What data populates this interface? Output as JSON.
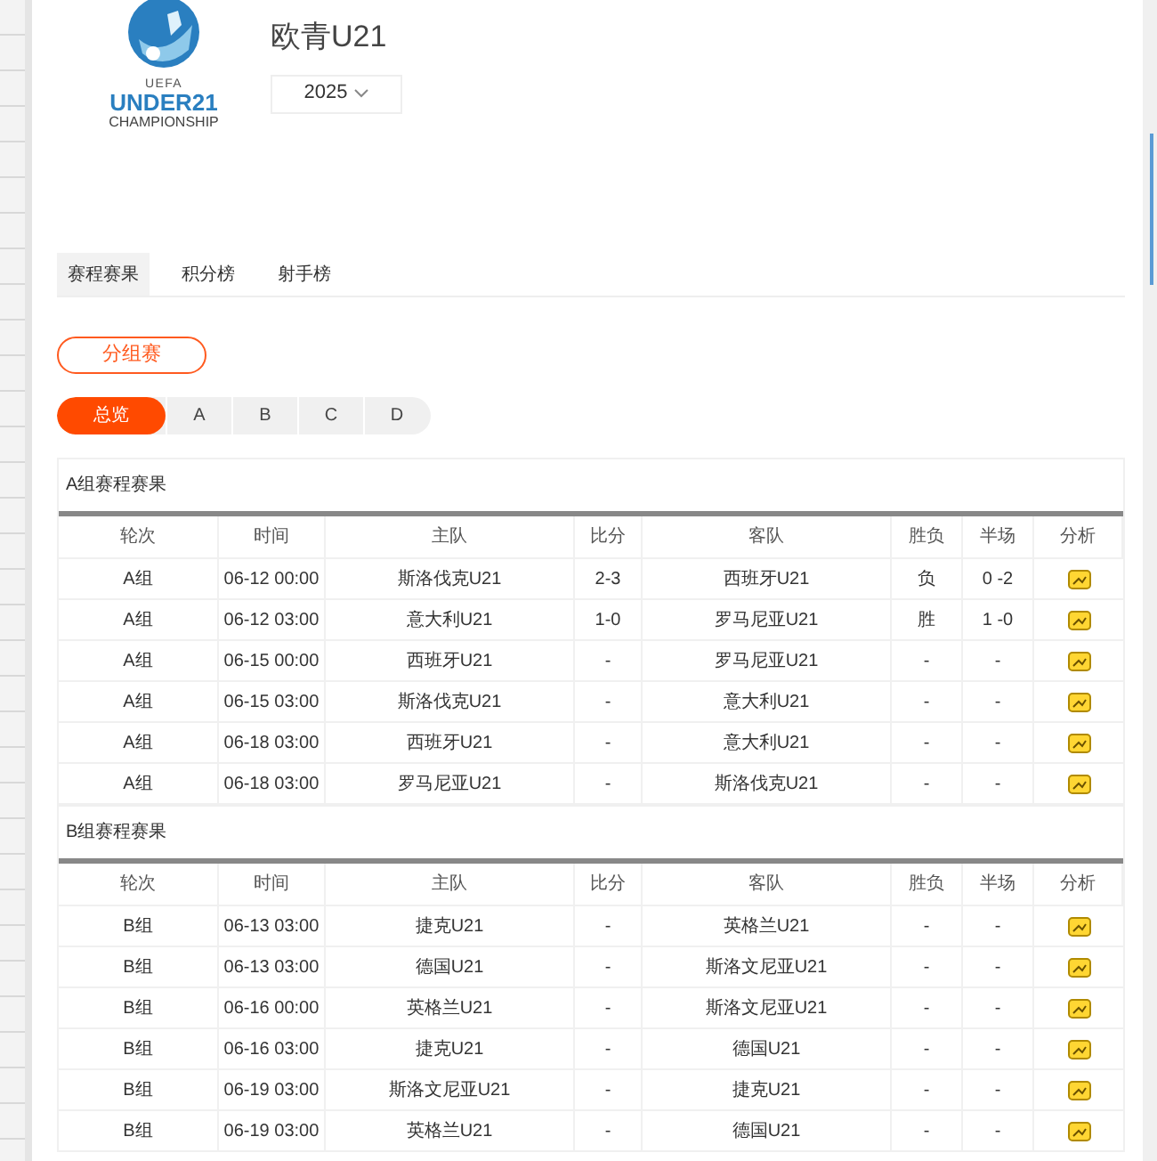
{
  "logo": {
    "top": "UEFA",
    "main": "UNDER21",
    "sub": "CHAMPIONSHIP"
  },
  "title": "欧青U21",
  "season": {
    "value": "2025"
  },
  "tabs": [
    {
      "label": "赛程赛果",
      "selected": true
    },
    {
      "label": "积分榜",
      "selected": false
    },
    {
      "label": "射手榜",
      "selected": false
    }
  ],
  "stage": {
    "label": "分组赛",
    "selected": true
  },
  "group_filters": [
    {
      "label": "总览",
      "selected": true
    },
    {
      "label": "A",
      "selected": false
    },
    {
      "label": "B",
      "selected": false
    },
    {
      "label": "C",
      "selected": false
    },
    {
      "label": "D",
      "selected": false
    }
  ],
  "sections": [
    {
      "title": "A组赛程赛果",
      "columns": [
        "轮次",
        "时间",
        "主队",
        "比分",
        "客队",
        "胜负",
        "半场",
        "分析"
      ],
      "rows": [
        {
          "round": "A组",
          "time": "06-12 00:00",
          "home": "斯洛伐克U21",
          "score": "2-3",
          "away": "西班牙U21",
          "result": "负",
          "half": "0 -2"
        },
        {
          "round": "A组",
          "time": "06-12 03:00",
          "home": "意大利U21",
          "score": "1-0",
          "away": "罗马尼亚U21",
          "result": "胜",
          "half": "1 -0"
        },
        {
          "round": "A组",
          "time": "06-15 00:00",
          "home": "西班牙U21",
          "score": "-",
          "away": "罗马尼亚U21",
          "result": "-",
          "half": "-"
        },
        {
          "round": "A组",
          "time": "06-15 03:00",
          "home": "斯洛伐克U21",
          "score": "-",
          "away": "意大利U21",
          "result": "-",
          "half": "-"
        },
        {
          "round": "A组",
          "time": "06-18 03:00",
          "home": "西班牙U21",
          "score": "-",
          "away": "意大利U21",
          "result": "-",
          "half": "-"
        },
        {
          "round": "A组",
          "time": "06-18 03:00",
          "home": "罗马尼亚U21",
          "score": "-",
          "away": "斯洛伐克U21",
          "result": "-",
          "half": "-"
        }
      ]
    },
    {
      "title": "B组赛程赛果",
      "columns": [
        "轮次",
        "时间",
        "主队",
        "比分",
        "客队",
        "胜负",
        "半场",
        "分析"
      ],
      "rows": [
        {
          "round": "B组",
          "time": "06-13 03:00",
          "home": "捷克U21",
          "score": "-",
          "away": "英格兰U21",
          "result": "-",
          "half": "-"
        },
        {
          "round": "B组",
          "time": "06-13 03:00",
          "home": "德国U21",
          "score": "-",
          "away": "斯洛文尼亚U21",
          "result": "-",
          "half": "-"
        },
        {
          "round": "B组",
          "time": "06-16 00:00",
          "home": "英格兰U21",
          "score": "-",
          "away": "斯洛文尼亚U21",
          "result": "-",
          "half": "-"
        },
        {
          "round": "B组",
          "time": "06-16 03:00",
          "home": "捷克U21",
          "score": "-",
          "away": "德国U21",
          "result": "-",
          "half": "-"
        },
        {
          "round": "B组",
          "time": "06-19 03:00",
          "home": "斯洛文尼亚U21",
          "score": "-",
          "away": "捷克U21",
          "result": "-",
          "half": "-"
        },
        {
          "round": "B组",
          "time": "06-19 03:00",
          "home": "英格兰U21",
          "score": "-",
          "away": "德国U21",
          "result": "-",
          "half": "-"
        }
      ]
    }
  ]
}
